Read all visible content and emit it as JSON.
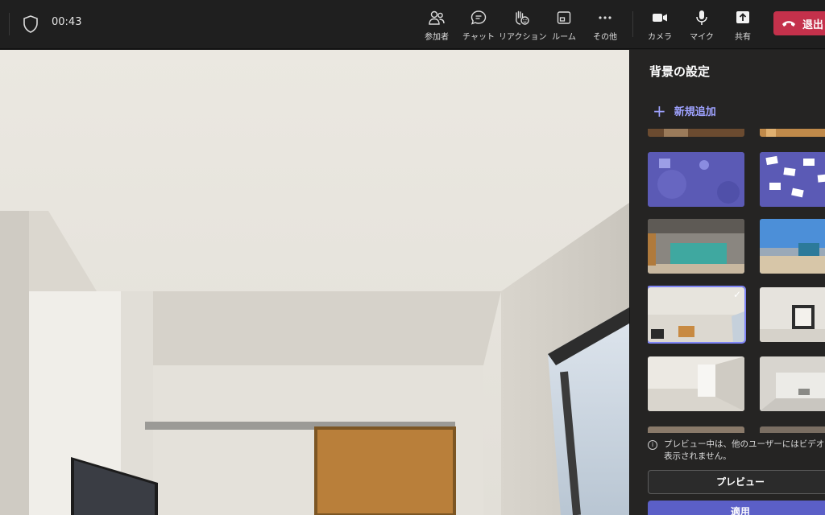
{
  "meeting": {
    "timer": "00:43"
  },
  "toolbar": {
    "items": [
      {
        "label": "参加者",
        "icon": "people-icon"
      },
      {
        "label": "チャット",
        "icon": "chat-icon"
      },
      {
        "label": "リアクション",
        "icon": "reaction-icon"
      },
      {
        "label": "ルーム",
        "icon": "rooms-icon"
      },
      {
        "label": "その他",
        "icon": "more-icon"
      },
      {
        "label": "カメラ",
        "icon": "camera-icon"
      },
      {
        "label": "マイク",
        "icon": "mic-icon"
      },
      {
        "label": "共有",
        "icon": "share-icon"
      }
    ],
    "leave_label": "退出",
    "leave_color": "#c4314b"
  },
  "panel": {
    "title": "背景の設定",
    "add_new_label": "新規追加",
    "notice_text": "プレビュー中は、他のユーザーにはビデオは表示されません。",
    "preview_label": "プレビュー",
    "apply_label": "適用",
    "selected_background": "白い部屋",
    "accent": "#7f85f5"
  }
}
